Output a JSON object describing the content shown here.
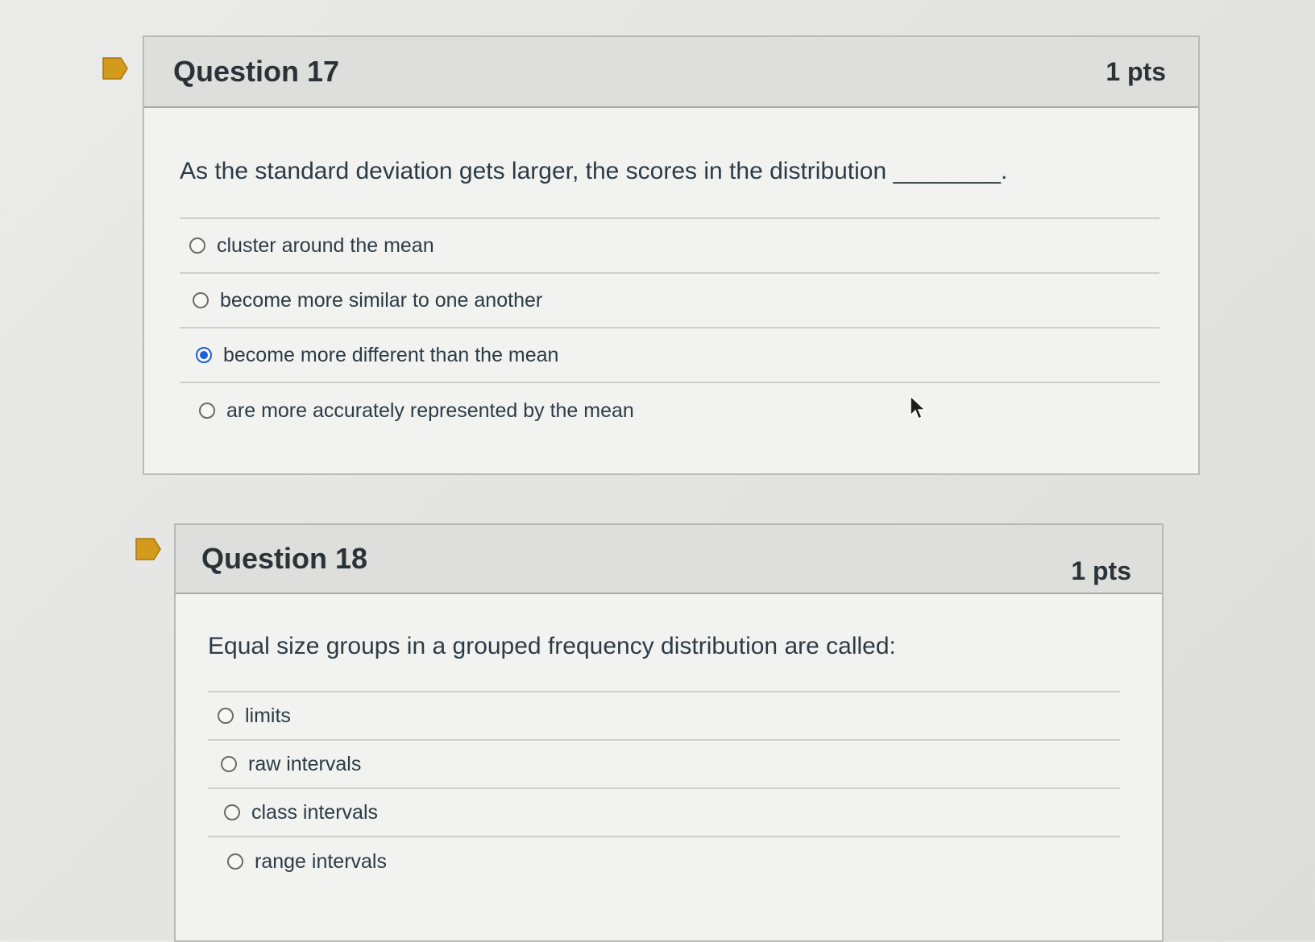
{
  "questions": [
    {
      "title": "Question 17",
      "points": "1 pts",
      "text": "As the standard deviation gets larger, the scores in the distribution ________.",
      "answers": [
        {
          "label": "cluster around the mean",
          "selected": false
        },
        {
          "label": "become more similar to one another",
          "selected": false
        },
        {
          "label": "become more different than the mean",
          "selected": true
        },
        {
          "label": "are more accurately represented by the mean",
          "selected": false
        }
      ]
    },
    {
      "title": "Question 18",
      "points": "1 pts",
      "text": "Equal size groups in a grouped frequency distribution are called:",
      "answers": [
        {
          "label": "limits",
          "selected": false
        },
        {
          "label": "raw intervals",
          "selected": false
        },
        {
          "label": "class intervals",
          "selected": false
        },
        {
          "label": "range intervals",
          "selected": false
        }
      ]
    }
  ],
  "icons": {
    "flag": "bookmark-flag-icon",
    "cursor": "mouse-pointer-icon"
  },
  "colors": {
    "flag": "#d39a1c",
    "selected_radio": "#1b5fd6",
    "header_bg": "#dededc"
  }
}
